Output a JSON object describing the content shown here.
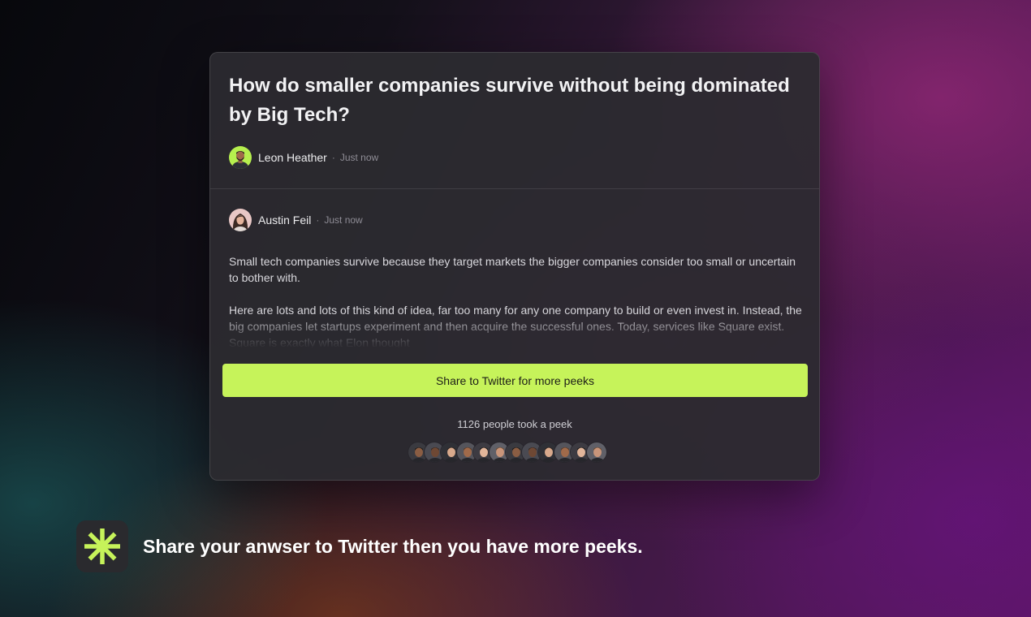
{
  "question": {
    "title": "How do smaller companies survive without being dominated by Big Tech?",
    "author": "Leon Heather",
    "separator": "·",
    "time": "Just now"
  },
  "answer": {
    "author": "Austin Feil",
    "separator": "·",
    "time": "Just now",
    "paragraphs": [
      "Small tech companies survive because they target markets the bigger companies consider too small or uncertain to bother with.",
      "Here are lots and lots of this kind of idea, far too many for any one company to build or even invest in. Instead, the big companies let startups experiment and then acquire the successful ones. Today, services like Square exist. Square is exactly what Elon thought"
    ]
  },
  "share_button": {
    "label": "Share to Twitter for more peeks"
  },
  "peeks": {
    "count_text": "1126 people took a peek",
    "avatar_count": 12
  },
  "footer": {
    "icon": "asterisk-icon",
    "tagline": "Share your anwser to Twitter then you have more peeks."
  },
  "colors": {
    "accent": "#c6f35a",
    "card_bg": "#2c2a30",
    "logo_tile": "#2a2a2e"
  }
}
